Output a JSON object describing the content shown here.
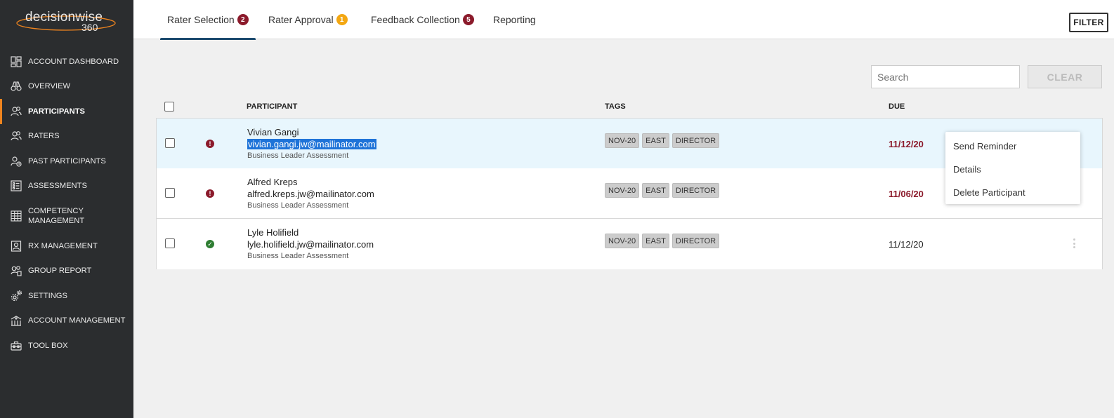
{
  "logo": {
    "name": "decisionwise",
    "sub": "360"
  },
  "sidebar": {
    "items": [
      {
        "label": "ACCOUNT DASHBOARD",
        "icon": "dashboard-icon"
      },
      {
        "label": "OVERVIEW",
        "icon": "binoculars-icon"
      },
      {
        "label": "PARTICIPANTS",
        "icon": "users-icon",
        "active": true
      },
      {
        "label": "RATERS",
        "icon": "users-icon"
      },
      {
        "label": "PAST PARTICIPANTS",
        "icon": "users-history-icon"
      },
      {
        "label": "ASSESSMENTS",
        "icon": "list-icon"
      },
      {
        "label": "COMPETENCY MANAGEMENT",
        "icon": "grid-icon"
      },
      {
        "label": "RX MANAGEMENT",
        "icon": "rx-icon"
      },
      {
        "label": "GROUP REPORT",
        "icon": "group-report-icon"
      },
      {
        "label": "SETTINGS",
        "icon": "gear-icon"
      },
      {
        "label": "ACCOUNT MANAGEMENT",
        "icon": "account-icon"
      },
      {
        "label": "TOOL BOX",
        "icon": "toolbox-icon"
      }
    ]
  },
  "tabs": [
    {
      "label": "Rater Selection",
      "badge": "2",
      "badge_color": "#8b1a2b",
      "active": true
    },
    {
      "label": "Rater Approval",
      "badge": "1",
      "badge_color": "#f3a712"
    },
    {
      "label": "Feedback Collection",
      "badge": "5",
      "badge_color": "#8b1a2b"
    },
    {
      "label": "Reporting"
    }
  ],
  "filter_label": "FILTER",
  "search": {
    "placeholder": "Search",
    "clear_label": "CLEAR"
  },
  "table": {
    "headers": {
      "participant": "PARTICIPANT",
      "tags": "TAGS",
      "due": "DUE"
    },
    "rows": [
      {
        "name": "Vivian Gangi",
        "email": "vivian.gangi.jw@mailinator.com",
        "assessment": "Business Leader Assessment",
        "tags": [
          "NOV-20",
          "EAST",
          "DIRECTOR"
        ],
        "due": "11/12/20",
        "status": "error",
        "overdue": true,
        "selected_text": true
      },
      {
        "name": "Alfred Kreps",
        "email": "alfred.kreps.jw@mailinator.com",
        "assessment": "Business Leader Assessment",
        "tags": [
          "NOV-20",
          "EAST",
          "DIRECTOR"
        ],
        "due": "11/06/20",
        "status": "error",
        "overdue": true
      },
      {
        "name": "Lyle Holifield",
        "email": "lyle.holifield.jw@mailinator.com",
        "assessment": "Business Leader Assessment",
        "tags": [
          "NOV-20",
          "EAST",
          "DIRECTOR"
        ],
        "due": "11/12/20",
        "status": "ok",
        "overdue": false
      }
    ]
  },
  "context_menu": {
    "items": [
      "Send Reminder",
      "Details",
      "Delete Participant"
    ]
  },
  "colors": {
    "sidebar_bg": "#2b2d2f",
    "accent": "#f0851f",
    "tab_underline": "#1c4a6e",
    "overdue": "#8b1a2b",
    "row_highlight": "#e8f6fd"
  }
}
